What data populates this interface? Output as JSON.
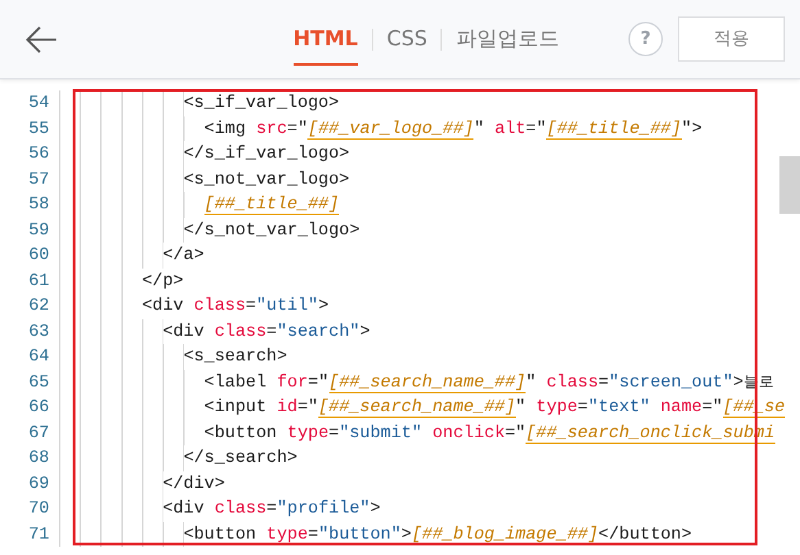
{
  "header": {
    "tabs": [
      {
        "label": "HTML",
        "selected": true
      },
      {
        "label": "CSS",
        "selected": false
      },
      {
        "label": "파일업로드",
        "selected": false
      }
    ],
    "help": "?",
    "apply_button": "적용"
  },
  "editor": {
    "lines": [
      {
        "children": [
          {
            "children": [
              {
                "number": "54",
                "tokens": [
                  {
                    "kind": "tag",
                    "text": "<s_if_var_logo>"
                  }
                ],
                "children": [
                  {
                    "number": "55",
                    "tokens": [
                      {
                        "kind": "tag",
                        "text": "<img "
                      },
                      {
                        "kind": "attr",
                        "text": "src"
                      },
                      {
                        "kind": "punct",
                        "text": "=\""
                      },
                      {
                        "kind": "var",
                        "text": "[##_var_logo_##]"
                      },
                      {
                        "kind": "punct",
                        "text": "\" "
                      },
                      {
                        "kind": "attr",
                        "text": "alt"
                      },
                      {
                        "kind": "punct",
                        "text": "=\""
                      },
                      {
                        "kind": "var",
                        "text": "[##_title_##]"
                      },
                      {
                        "kind": "punct",
                        "text": "\">"
                      }
                    ]
                  }
                ]
              },
              {
                "number": "56",
                "tokens": [
                  {
                    "kind": "tag",
                    "text": "</s_if_var_logo>"
                  }
                ]
              },
              {
                "number": "57",
                "tokens": [
                  {
                    "kind": "tag",
                    "text": "<s_not_var_logo>"
                  }
                ],
                "children": [
                  {
                    "number": "58",
                    "tokens": [
                      {
                        "kind": "var",
                        "text": "[##_title_##]"
                      }
                    ]
                  }
                ]
              },
              {
                "number": "59",
                "tokens": [
                  {
                    "kind": "tag",
                    "text": "</s_not_var_logo>"
                  }
                ]
              }
            ]
          },
          {
            "number": "60",
            "tokens": [
              {
                "kind": "tag",
                "text": "</a>"
              }
            ]
          }
        ]
      },
      {
        "number": "61",
        "tokens": [
          {
            "kind": "tag",
            "text": "</p>"
          }
        ]
      },
      {
        "number": "62",
        "tokens": [
          {
            "kind": "tag",
            "text": "<div "
          },
          {
            "kind": "attr",
            "text": "class"
          },
          {
            "kind": "punct",
            "text": "="
          },
          {
            "kind": "string",
            "text": "\"util\""
          },
          {
            "kind": "tag",
            "text": ">"
          }
        ],
        "children": [
          {
            "number": "63",
            "tokens": [
              {
                "kind": "tag",
                "text": "<div "
              },
              {
                "kind": "attr",
                "text": "class"
              },
              {
                "kind": "punct",
                "text": "="
              },
              {
                "kind": "string",
                "text": "\"search\""
              },
              {
                "kind": "tag",
                "text": ">"
              }
            ],
            "children": [
              {
                "number": "64",
                "tokens": [
                  {
                    "kind": "tag",
                    "text": "<s_search>"
                  }
                ],
                "children": [
                  {
                    "number": "65",
                    "tokens": [
                      {
                        "kind": "tag",
                        "text": "<label "
                      },
                      {
                        "kind": "attr",
                        "text": "for"
                      },
                      {
                        "kind": "punct",
                        "text": "=\""
                      },
                      {
                        "kind": "var",
                        "text": "[##_search_name_##]"
                      },
                      {
                        "kind": "punct",
                        "text": "\" "
                      },
                      {
                        "kind": "attr",
                        "text": "class"
                      },
                      {
                        "kind": "punct",
                        "text": "="
                      },
                      {
                        "kind": "string",
                        "text": "\"screen_out\""
                      },
                      {
                        "kind": "tag",
                        "text": ">"
                      },
                      {
                        "kind": "text",
                        "text": "블로"
                      }
                    ]
                  },
                  {
                    "number": "66",
                    "tokens": [
                      {
                        "kind": "tag",
                        "text": "<input "
                      },
                      {
                        "kind": "attr",
                        "text": "id"
                      },
                      {
                        "kind": "punct",
                        "text": "=\""
                      },
                      {
                        "kind": "var",
                        "text": "[##_search_name_##]"
                      },
                      {
                        "kind": "punct",
                        "text": "\" "
                      },
                      {
                        "kind": "attr",
                        "text": "type"
                      },
                      {
                        "kind": "punct",
                        "text": "="
                      },
                      {
                        "kind": "string",
                        "text": "\"text\" "
                      },
                      {
                        "kind": "attr",
                        "text": "name"
                      },
                      {
                        "kind": "punct",
                        "text": "=\""
                      },
                      {
                        "kind": "var",
                        "text": "[##_se"
                      }
                    ]
                  },
                  {
                    "number": "67",
                    "tokens": [
                      {
                        "kind": "tag",
                        "text": "<button "
                      },
                      {
                        "kind": "attr",
                        "text": "type"
                      },
                      {
                        "kind": "punct",
                        "text": "="
                      },
                      {
                        "kind": "string",
                        "text": "\"submit\" "
                      },
                      {
                        "kind": "attr",
                        "text": "onclick"
                      },
                      {
                        "kind": "punct",
                        "text": "=\""
                      },
                      {
                        "kind": "var",
                        "text": "[##_search_onclick_submi"
                      }
                    ]
                  }
                ]
              },
              {
                "number": "68",
                "tokens": [
                  {
                    "kind": "tag",
                    "text": "</s_search>"
                  }
                ]
              }
            ]
          },
          {
            "number": "69",
            "tokens": [
              {
                "kind": "tag",
                "text": "</div>"
              }
            ]
          },
          {
            "number": "70",
            "tokens": [
              {
                "kind": "tag",
                "text": "<div "
              },
              {
                "kind": "attr",
                "text": "class"
              },
              {
                "kind": "punct",
                "text": "="
              },
              {
                "kind": "string",
                "text": "\"profile\""
              },
              {
                "kind": "tag",
                "text": ">"
              }
            ],
            "children": [
              {
                "number": "71",
                "tokens": [
                  {
                    "kind": "tag",
                    "text": "<button "
                  },
                  {
                    "kind": "attr",
                    "text": "type"
                  },
                  {
                    "kind": "punct",
                    "text": "="
                  },
                  {
                    "kind": "string",
                    "text": "\"button\""
                  },
                  {
                    "kind": "tag",
                    "text": ">"
                  },
                  {
                    "kind": "var",
                    "text": "[##_blog_image_##]"
                  },
                  {
                    "kind": "tag",
                    "text": "</button>"
                  }
                ]
              }
            ]
          }
        ]
      }
    ]
  }
}
